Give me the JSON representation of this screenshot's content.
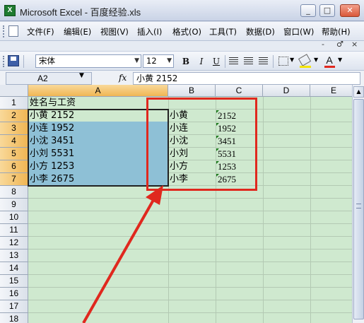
{
  "window": {
    "title": "Microsoft Excel - 百度经验.xls",
    "minimize": "_",
    "maximize": "□",
    "close": "✕"
  },
  "menu": {
    "items": [
      "文件(F)",
      "编辑(E)",
      "视图(V)",
      "插入(I)",
      "格式(O)",
      "工具(T)",
      "数据(D)",
      "窗口(W)",
      "帮助(H)"
    ],
    "doc_controls": [
      "-",
      "♂",
      "×"
    ]
  },
  "toolbar": {
    "font_name": "宋体",
    "font_size": "12",
    "bold": "B",
    "italic": "I",
    "underline": "U",
    "font_color_label": "A"
  },
  "formula_bar": {
    "name_box": "A2",
    "fx": "fx",
    "content": "小黄  2152"
  },
  "sheet": {
    "columns": [
      "A",
      "B",
      "C",
      "D",
      "E"
    ],
    "rows": [
      "1",
      "2",
      "3",
      "4",
      "5",
      "6",
      "7",
      "8",
      "9",
      "10",
      "11",
      "12",
      "13",
      "14",
      "15",
      "16",
      "17",
      "18"
    ],
    "a_cells": [
      "姓名与工资",
      "小黄  2152",
      "小连  1952",
      "小沈  3451",
      "小刘  5531",
      "小方  1253",
      "小李  2675"
    ],
    "b_cells": [
      "小黄",
      "小连",
      "小沈",
      "小刘",
      "小方",
      "小李"
    ],
    "c_cells": [
      "2152",
      "1952",
      "3451",
      "5531",
      "1253",
      "2675"
    ]
  },
  "colors": {
    "sheet_background": "#cfe9cf",
    "selection": "#8ec0d6",
    "annotation": "#e0281e",
    "header_selected": "#f0b654"
  }
}
